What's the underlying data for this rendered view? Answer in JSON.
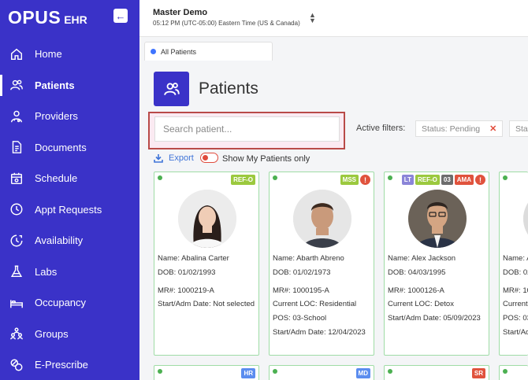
{
  "app": {
    "logo_main": "OPUS",
    "logo_sub": "EHR",
    "collapse_glyph": "←"
  },
  "header": {
    "org_name": "Master Demo",
    "org_time": "05:12 PM (UTC-05:00) Eastern Time (US & Canada)"
  },
  "tabs": [
    {
      "label": "All Patients"
    }
  ],
  "sidebar": {
    "items": [
      {
        "label": "Home",
        "icon": "home-icon"
      },
      {
        "label": "Patients",
        "icon": "users-icon",
        "active": true
      },
      {
        "label": "Providers",
        "icon": "provider-icon"
      },
      {
        "label": "Documents",
        "icon": "document-icon"
      },
      {
        "label": "Schedule",
        "icon": "calendar-icon"
      },
      {
        "label": "Appt Requests",
        "icon": "clock-icon"
      },
      {
        "label": "Availability",
        "icon": "availability-icon"
      },
      {
        "label": "Labs",
        "icon": "flask-icon"
      },
      {
        "label": "Occupancy",
        "icon": "bed-icon"
      },
      {
        "label": "Groups",
        "icon": "groups-icon"
      },
      {
        "label": "E-Prescribe",
        "icon": "pills-icon"
      }
    ]
  },
  "page": {
    "title": "Patients",
    "search_placeholder": "Search patient...",
    "active_filters_label": "Active filters:",
    "filters": [
      {
        "label": "Status: Pending"
      },
      {
        "label": "Stat"
      }
    ],
    "export_label": "Export",
    "my_patients_label": "Show My Patients only"
  },
  "cards": [
    {
      "name": "Name: Abalina Carter",
      "dob": "DOB: 01/02/1993",
      "mr": "MR#: 1000219-A",
      "start": "Start/Adm Date: Not selected",
      "badges": [
        "REF-O"
      ]
    },
    {
      "name": "Name: Abarth Abreno",
      "dob": "DOB: 01/02/1973",
      "mr": "MR#: 1000195-A",
      "loc": "Current LOC: Residential",
      "pos": "POS: 03-School",
      "start": "Start/Adm Date: 12/04/2023",
      "badges": [
        "MSS",
        "!"
      ]
    },
    {
      "name": "Name: Alex Jackson",
      "dob": "DOB: 04/03/1995",
      "mr": "MR#: 1000126-A",
      "loc": "Current LOC: Detox",
      "start": "Start/Adm Date: 05/09/2023",
      "badges": [
        "LT",
        "REF-O",
        "03",
        "AMA",
        "!"
      ]
    },
    {
      "name": "Name: A",
      "dob": "DOB: 02",
      "mr": "MR#: 10",
      "loc": "Current",
      "pos": "POS: 03",
      "start": "Start/Ad"
    }
  ],
  "bottom_cards": [
    {
      "badges": [
        "HR"
      ]
    },
    {
      "badges": [
        "MD"
      ]
    },
    {
      "badges": [
        "SR"
      ]
    }
  ],
  "colors": {
    "sidebar": "#3a32c8",
    "accent": "#3f74ff",
    "card_border": "#9fdca6",
    "alert": "#e0533d"
  }
}
